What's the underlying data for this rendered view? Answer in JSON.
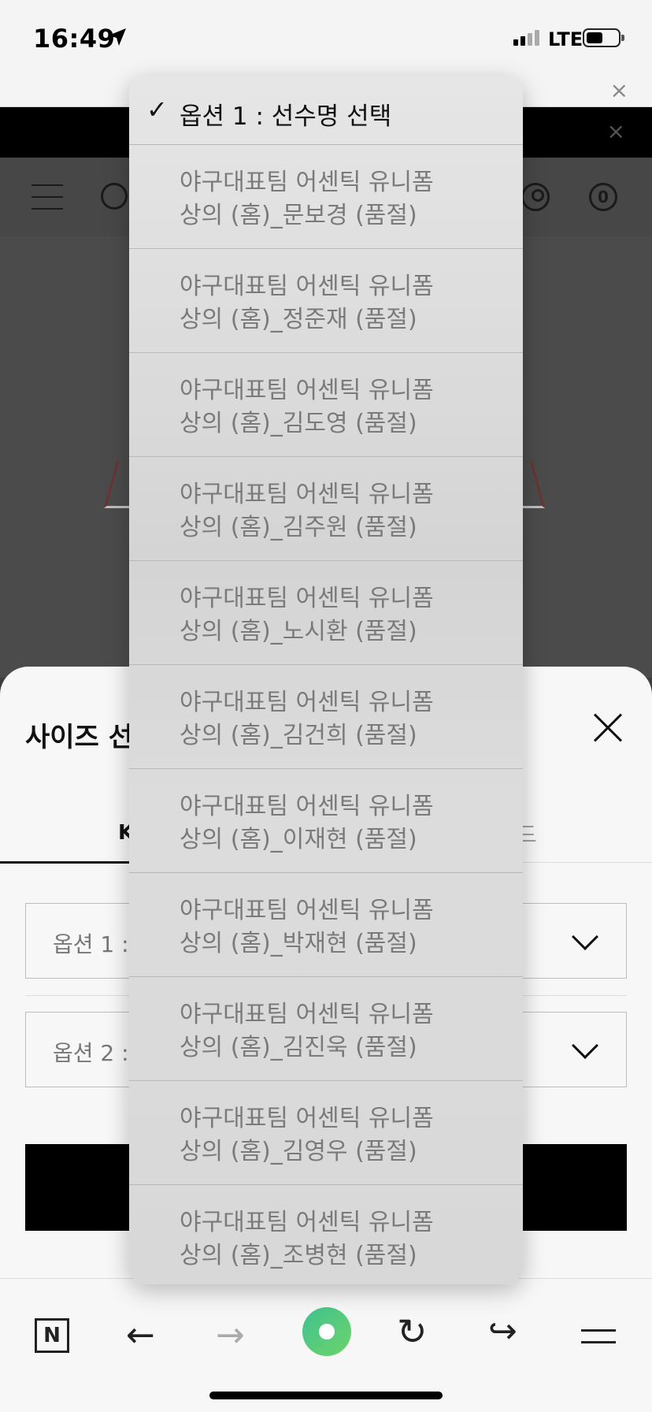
{
  "status_bar": {
    "time": "16:49",
    "network": "LTE"
  },
  "page": {
    "cart_count": "0"
  },
  "sheet": {
    "title": "사이즈 선",
    "tab_left": "K",
    "tab_right": "드",
    "option1_label": "옵션 1 :",
    "option2_label": "옵션 2 :"
  },
  "picker": {
    "selected": "옵션 1 : 선수명 선택",
    "items": [
      {
        "line1": "야구대표팀 어센틱 유니폼",
        "line2": "상의 (홈)_문보경 (품절)"
      },
      {
        "line1": "야구대표팀 어센틱 유니폼",
        "line2": "상의 (홈)_정준재 (품절)"
      },
      {
        "line1": "야구대표팀 어센틱 유니폼",
        "line2": "상의 (홈)_김도영 (품절)"
      },
      {
        "line1": "야구대표팀 어센틱 유니폼",
        "line2": "상의 (홈)_김주원 (품절)"
      },
      {
        "line1": "야구대표팀 어센틱 유니폼",
        "line2": "상의 (홈)_노시환 (품절)"
      },
      {
        "line1": "야구대표팀 어센틱 유니폼",
        "line2": "상의 (홈)_김건희 (품절)"
      },
      {
        "line1": "야구대표팀 어센틱 유니폼",
        "line2": "상의 (홈)_이재현 (품절)"
      },
      {
        "line1": "야구대표팀 어센틱 유니폼",
        "line2": "상의 (홈)_박재현 (품절)"
      },
      {
        "line1": "야구대표팀 어센틱 유니폼",
        "line2": "상의 (홈)_김진욱 (품절)"
      },
      {
        "line1": "야구대표팀 어센틱 유니폼",
        "line2": "상의 (홈)_김영우 (품절)"
      },
      {
        "line1": "야구대표팀 어센틱 유니폼",
        "line2": "상의 (홈)_조병현 (품절)"
      }
    ]
  },
  "toolbar": {
    "naver_label": "N",
    "back_glyph": "←",
    "forward_glyph": "→",
    "reload_glyph": "↻",
    "share_glyph": "↪"
  },
  "icons": {
    "close_glyph": "×"
  }
}
